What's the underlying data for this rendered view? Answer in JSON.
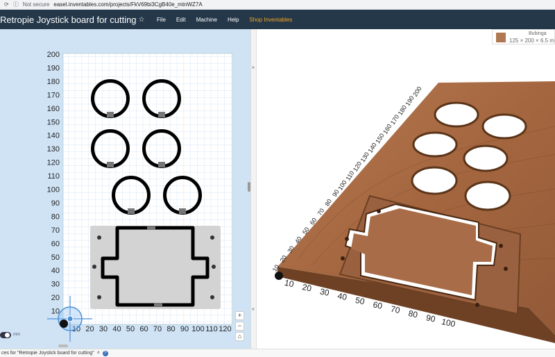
{
  "browser": {
    "reload_icon": "reload-icon",
    "security_label": "Not secure",
    "url": "easel.inventables.com/projects/FkV69bi3CgB40e_mtnWZ7A"
  },
  "header": {
    "title": "Retropie Joystick board for cutting",
    "star": "☆",
    "menu": [
      "File",
      "Edit",
      "Machine",
      "Help",
      "Shop Inventables"
    ],
    "accent_color": "#f5a623",
    "header_color": "#25384a"
  },
  "material": {
    "name": "Bubinga",
    "dims": "125 × 200 × 6.5 m"
  },
  "canvas": {
    "y_ticks": [
      "200",
      "190",
      "180",
      "170",
      "160",
      "150",
      "140",
      "130",
      "120",
      "110",
      "100",
      "90",
      "80",
      "70",
      "60",
      "50",
      "40",
      "30",
      "20",
      "10"
    ],
    "x_ticks": [
      "10",
      "20",
      "30",
      "40",
      "50",
      "60",
      "70",
      "80",
      "90",
      "100",
      "110",
      "120"
    ]
  },
  "preview": {
    "y_ticks": [
      "200",
      "190",
      "180",
      "170",
      "160",
      "150",
      "140",
      "130",
      "120",
      "110",
      "100",
      "90",
      "80",
      "70",
      "60",
      "50",
      "40",
      "30",
      "20",
      "10"
    ],
    "x_ticks": [
      "10",
      "20",
      "30",
      "40",
      "50",
      "60",
      "70",
      "80",
      "90",
      "100"
    ],
    "wood_color": "#a86c48"
  },
  "footer": {
    "text": "ces for \"Retropie Joystick board for cutting\"",
    "help_icon": "help-icon"
  },
  "controls": {
    "zoom_in": "+",
    "zoom_out": "−",
    "home": "⌂",
    "units": "mm"
  }
}
